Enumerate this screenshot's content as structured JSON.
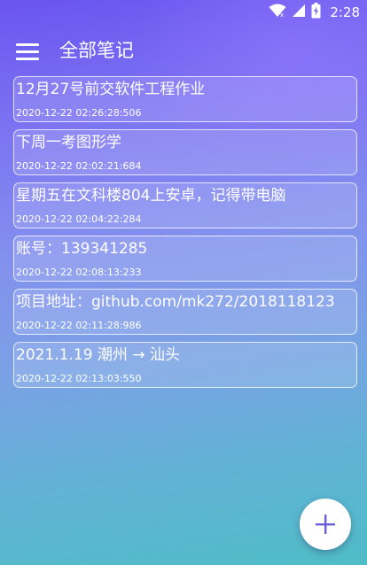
{
  "status_bar": {
    "time": "2:28",
    "icons": [
      "wifi-icon",
      "signal-icon",
      "battery-icon"
    ]
  },
  "toolbar": {
    "title": "全部笔记",
    "menu_icon": "hamburger-menu-icon"
  },
  "notes": [
    {
      "title": "12月27号前交软件工程作业",
      "time": "2020-12-22 02:26:28:506"
    },
    {
      "title": "下周一考图形学",
      "time": "2020-12-22 02:02:21:684"
    },
    {
      "title": "星期五在文科楼804上安卓，记得带电脑",
      "time": "2020-12-22 02:04:22:284"
    },
    {
      "title": "账号：139341285",
      "time": "2020-12-22 02:08:13:233"
    },
    {
      "title": "项目地址：github.com/mk272/2018118123",
      "time": "2020-12-22 02:11:28:986"
    },
    {
      "title": "2021.1.19 潮州 → 汕头",
      "time": "2020-12-22 02:13:03:550"
    }
  ],
  "fab": {
    "icon": "plus-icon",
    "color": "#6a5fd6"
  },
  "colors": {
    "gradient_top": "#6a55f0",
    "gradient_bottom": "#4fbcc7",
    "card_border": "#ffffff"
  }
}
